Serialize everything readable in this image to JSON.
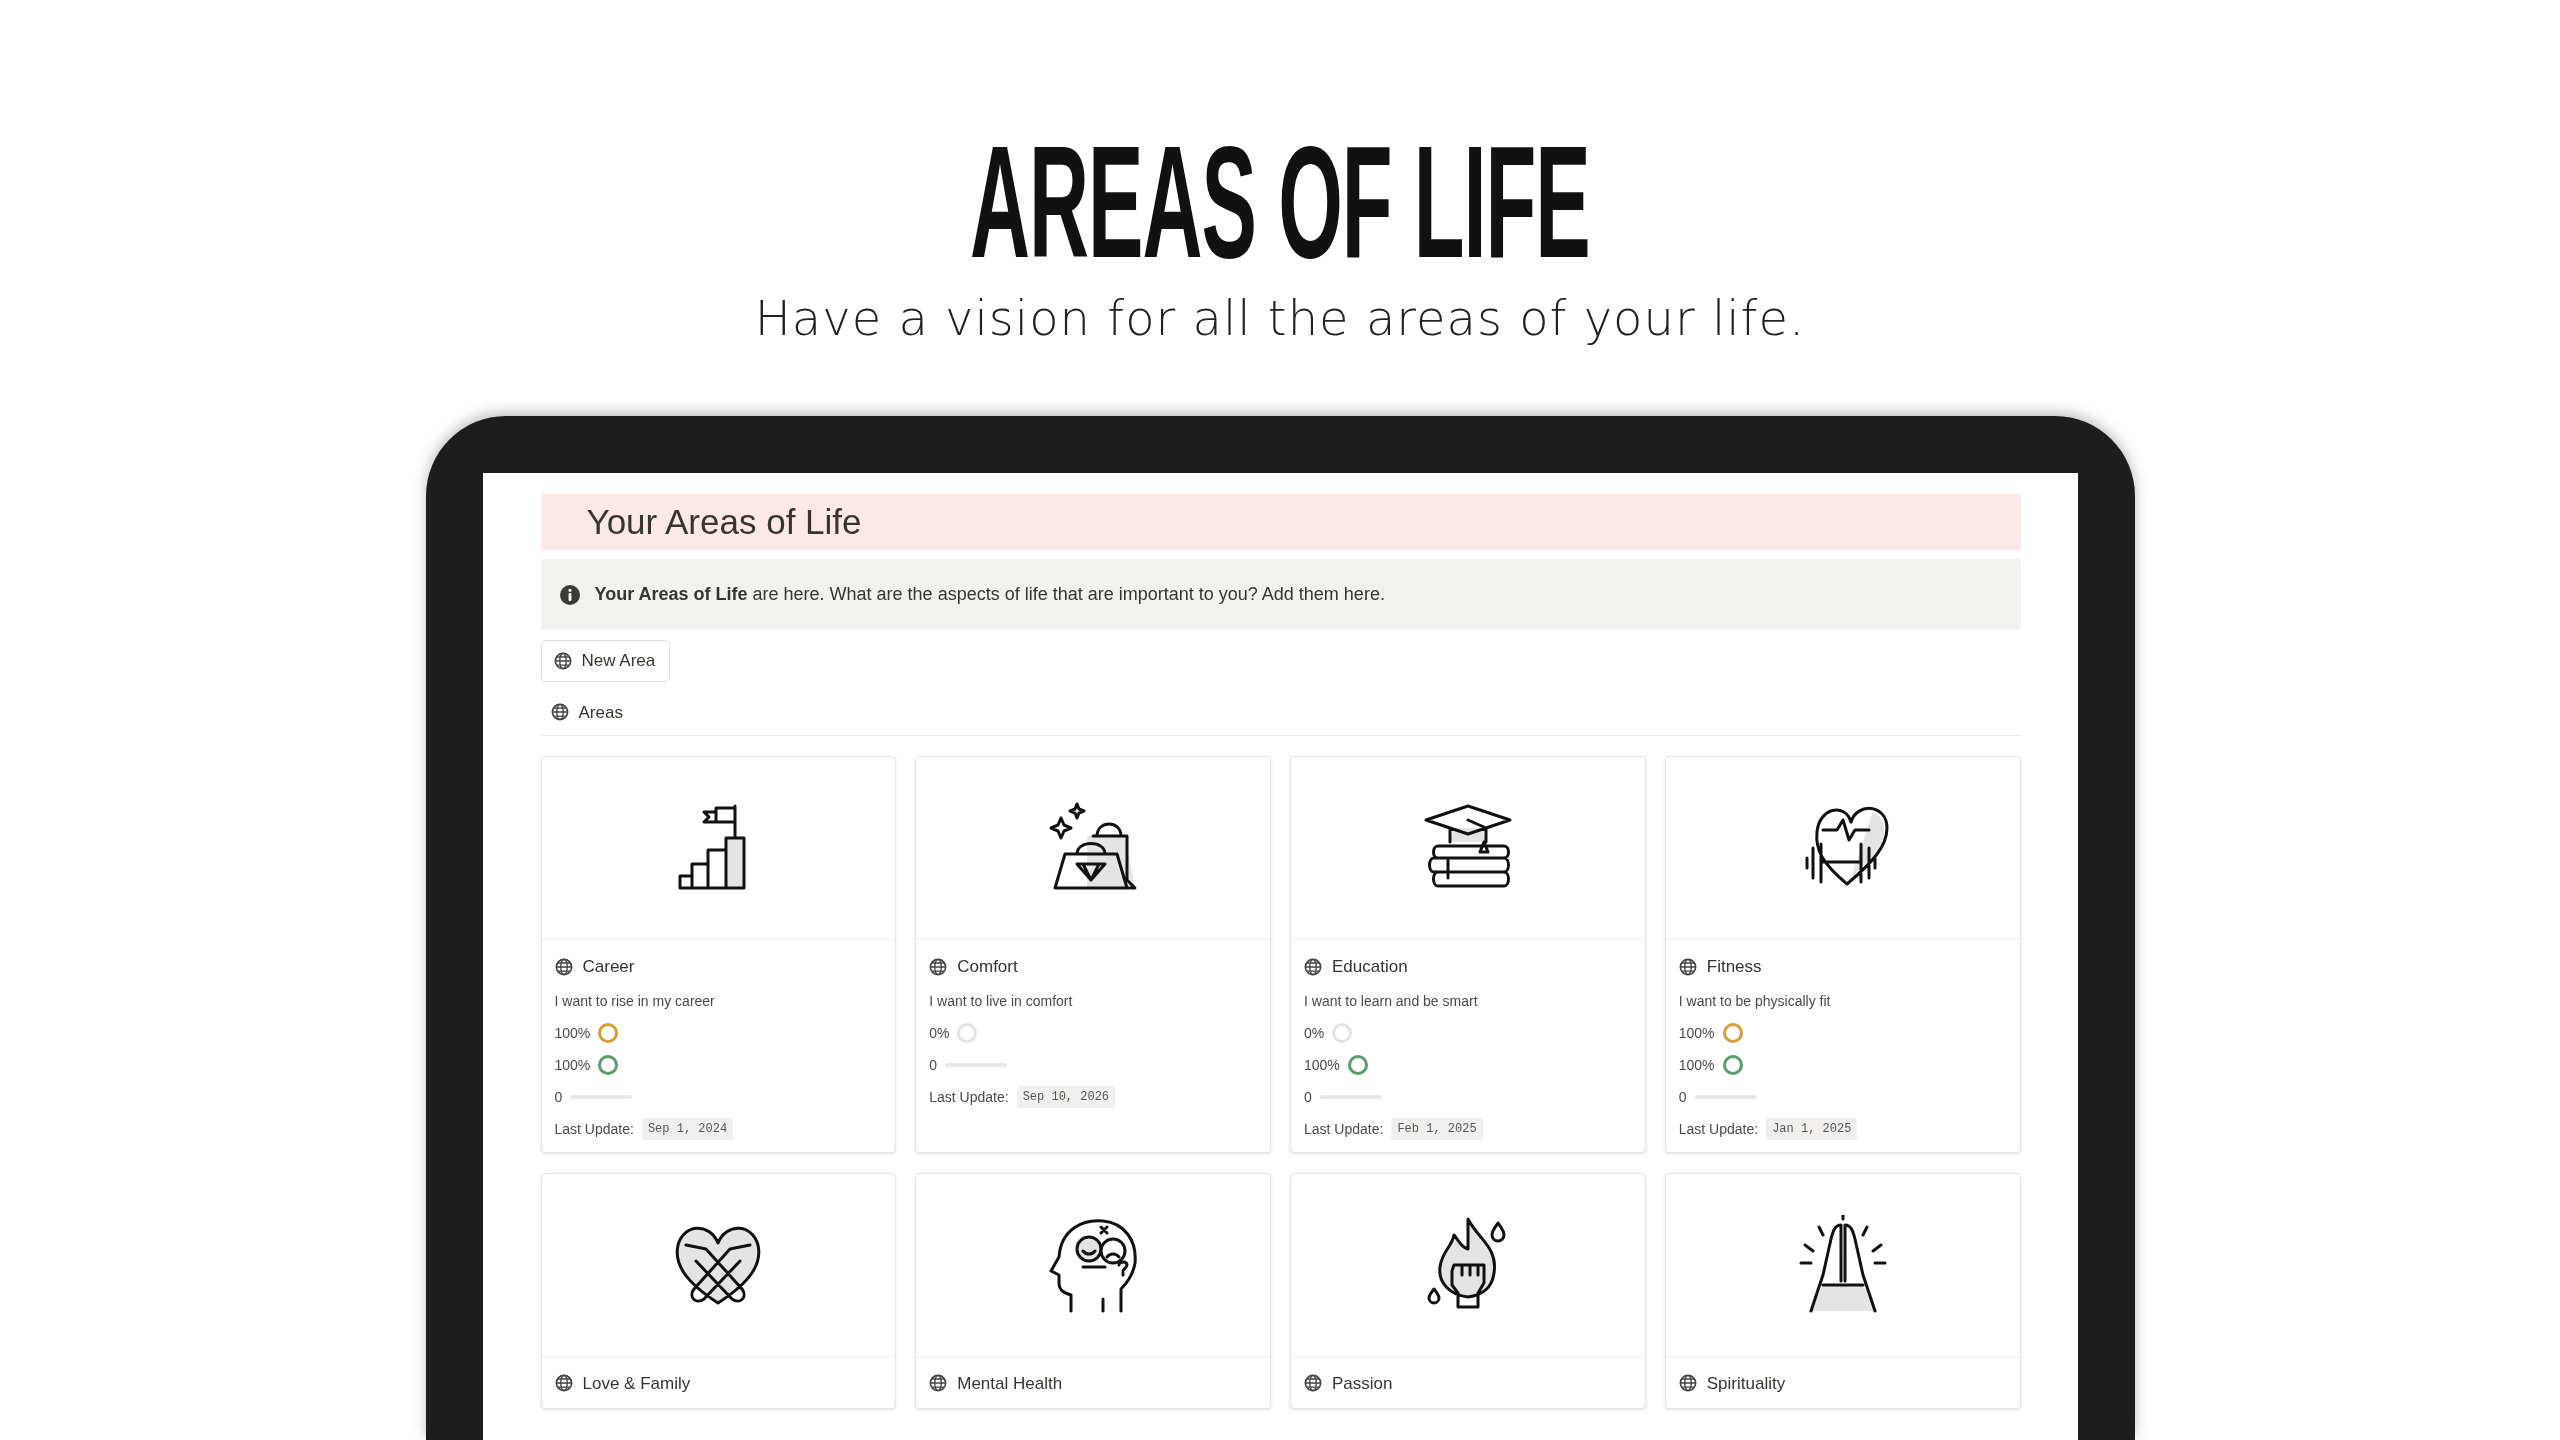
{
  "hero": {
    "title": "AREAS OF LIFE",
    "subtitle": "Have a vision for all the areas of your life."
  },
  "page": {
    "title": "Your Areas of Life",
    "callout": "**Your Areas of Life** are here. What are the aspects of life that are important to you? Add them here.",
    "new_button": "New Area",
    "view_tab": "Areas"
  },
  "cards": [
    {
      "name": "Career",
      "description": "I want to rise in my career",
      "metrics": [
        {
          "kind": "ring",
          "reading": "100%",
          "level": 1,
          "color": "#d4a03c"
        },
        {
          "kind": "ring",
          "reading": "100%",
          "level": 1,
          "color": "#5f9a73"
        },
        {
          "kind": "bar",
          "reading": "0",
          "level": 0
        }
      ],
      "last_update_label": "Last Update:",
      "last_update": "Sep 1, 2024"
    },
    {
      "name": "Comfort",
      "description": "I want to live in comfort",
      "metrics": [
        {
          "kind": "ring",
          "reading": "0%",
          "level": 0
        },
        {
          "kind": "bar",
          "reading": "0",
          "level": 0
        }
      ],
      "last_update_label": "Last Update:",
      "last_update": "Sep 10, 2026"
    },
    {
      "name": "Education",
      "description": "I want to learn and be smart",
      "metrics": [
        {
          "kind": "ring",
          "reading": "0%",
          "level": 0
        },
        {
          "kind": "ring",
          "reading": "100%",
          "level": 1,
          "color": "#5f9a73"
        },
        {
          "kind": "bar",
          "reading": "0",
          "level": 0
        }
      ],
      "last_update_label": "Last Update:",
      "last_update": "Feb 1, 2025"
    },
    {
      "name": "Fitness",
      "description": "I want to be physically fit",
      "metrics": [
        {
          "kind": "ring",
          "reading": "100%",
          "level": 1,
          "color": "#d4a03c"
        },
        {
          "kind": "ring",
          "reading": "100%",
          "level": 1,
          "color": "#5f9a73"
        },
        {
          "kind": "bar",
          "reading": "0",
          "level": 0
        }
      ],
      "last_update_label": "Last Update:",
      "last_update": "Jan 1, 2025"
    },
    {
      "name": "Love & Family"
    },
    {
      "name": "Mental Health"
    },
    {
      "name": "Passion"
    },
    {
      "name": "Spirituality"
    }
  ]
}
